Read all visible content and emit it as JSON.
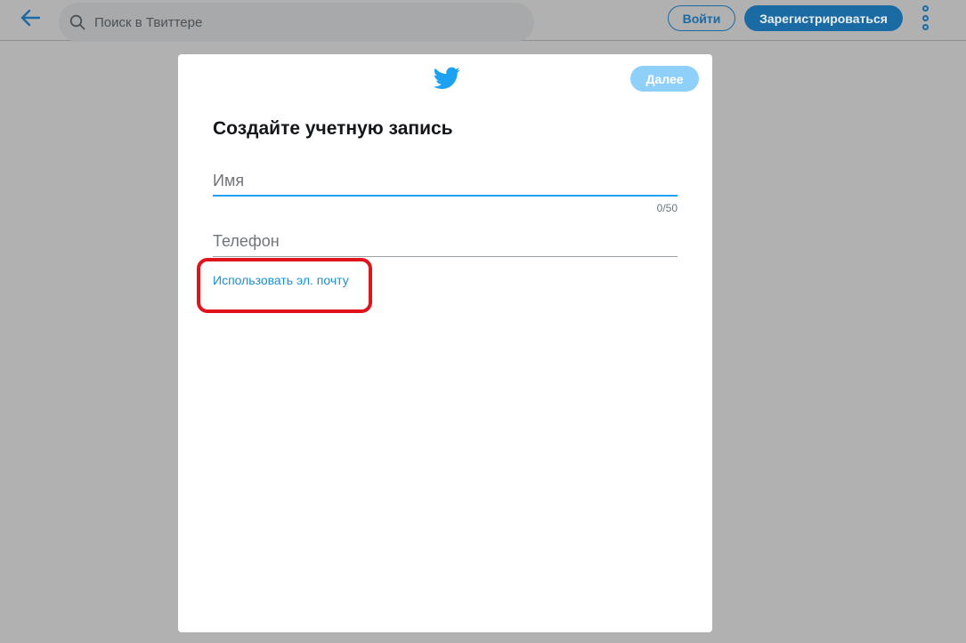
{
  "topbar": {
    "back_icon": "arrow-left-icon",
    "search": {
      "placeholder": "Поиск в Твиттере",
      "icon": "search-icon"
    },
    "login_label": "Войти",
    "signup_label": "Зарегистрироваться",
    "more_icon": "vertical-dots-icon"
  },
  "modal": {
    "logo_icon": "twitter-bird-icon",
    "next_label": "Далее",
    "title": "Создайте учетную запись",
    "name_field": {
      "placeholder": "Имя",
      "value": "",
      "counter": "0/50"
    },
    "phone_field": {
      "placeholder": "Телефон",
      "value": ""
    },
    "email_link": "Использовать эл. почту"
  },
  "colors": {
    "accent": "#1da1f2",
    "dark_blue": "#1a6aa3",
    "next_disabled": "#8ed0f9",
    "highlight": "#e0141c",
    "overlay": "#b1b1b1"
  }
}
